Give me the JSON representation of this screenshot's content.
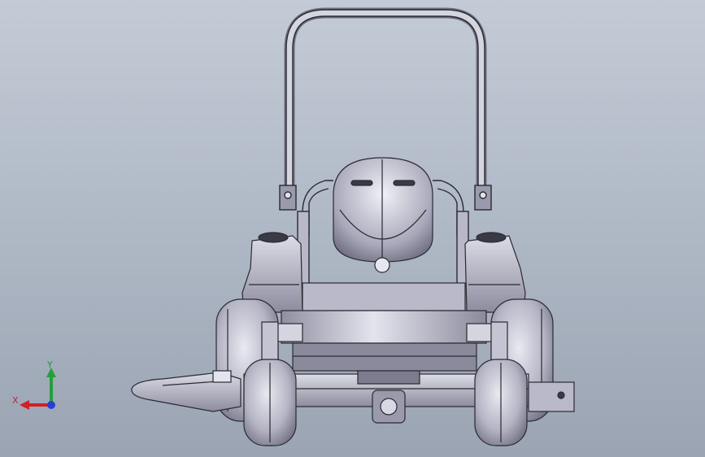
{
  "viewport": {
    "background_top": "#c3cbd6",
    "background_bottom": "#9aa4b2"
  },
  "model": {
    "subject": "zero-turn-mower-front-view",
    "body_color": "#c9c9d6",
    "line_color": "#2a2a33"
  },
  "triad": {
    "x_label": "X",
    "y_label": "Y",
    "x_color": "#d21f26",
    "y_color": "#22a03a",
    "z_color": "#2b3fd4"
  }
}
